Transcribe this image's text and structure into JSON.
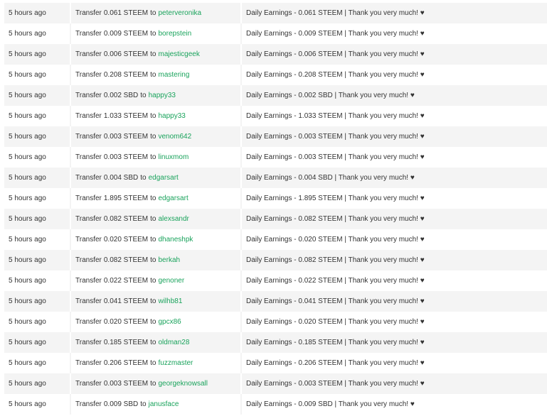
{
  "colors": {
    "link": "#1aa35c",
    "row_alt": "#f4f4f4",
    "text": "#333333"
  },
  "rows": [
    {
      "time": "5 hours ago",
      "verb": "Transfer",
      "amount": "0.061 STEEM",
      "conn": "to",
      "recipient": "peterveronika",
      "memo": "Daily Earnings - 0.061 STEEM | Thank you very much! ♥"
    },
    {
      "time": "5 hours ago",
      "verb": "Transfer",
      "amount": "0.009 STEEM",
      "conn": "to",
      "recipient": "borepstein",
      "memo": "Daily Earnings - 0.009 STEEM | Thank you very much! ♥"
    },
    {
      "time": "5 hours ago",
      "verb": "Transfer",
      "amount": "0.006 STEEM",
      "conn": "to",
      "recipient": "majesticgeek",
      "memo": "Daily Earnings - 0.006 STEEM | Thank you very much! ♥"
    },
    {
      "time": "5 hours ago",
      "verb": "Transfer",
      "amount": "0.208 STEEM",
      "conn": "to",
      "recipient": "mastering",
      "memo": "Daily Earnings - 0.208 STEEM | Thank you very much! ♥"
    },
    {
      "time": "5 hours ago",
      "verb": "Transfer",
      "amount": "0.002 SBD",
      "conn": "to",
      "recipient": "happy33",
      "memo": "Daily Earnings - 0.002 SBD | Thank you very much! ♥"
    },
    {
      "time": "5 hours ago",
      "verb": "Transfer",
      "amount": "1.033 STEEM",
      "conn": "to",
      "recipient": "happy33",
      "memo": "Daily Earnings - 1.033 STEEM | Thank you very much! ♥"
    },
    {
      "time": "5 hours ago",
      "verb": "Transfer",
      "amount": "0.003 STEEM",
      "conn": "to",
      "recipient": "venom642",
      "memo": "Daily Earnings - 0.003 STEEM | Thank you very much! ♥"
    },
    {
      "time": "5 hours ago",
      "verb": "Transfer",
      "amount": "0.003 STEEM",
      "conn": "to",
      "recipient": "linuxmom",
      "memo": "Daily Earnings - 0.003 STEEM | Thank you very much! ♥"
    },
    {
      "time": "5 hours ago",
      "verb": "Transfer",
      "amount": "0.004 SBD",
      "conn": "to",
      "recipient": "edgarsart",
      "memo": "Daily Earnings - 0.004 SBD | Thank you very much! ♥"
    },
    {
      "time": "5 hours ago",
      "verb": "Transfer",
      "amount": "1.895 STEEM",
      "conn": "to",
      "recipient": "edgarsart",
      "memo": "Daily Earnings - 1.895 STEEM | Thank you very much! ♥"
    },
    {
      "time": "5 hours ago",
      "verb": "Transfer",
      "amount": "0.082 STEEM",
      "conn": "to",
      "recipient": "alexsandr",
      "memo": "Daily Earnings - 0.082 STEEM | Thank you very much! ♥"
    },
    {
      "time": "5 hours ago",
      "verb": "Transfer",
      "amount": "0.020 STEEM",
      "conn": "to",
      "recipient": "dhaneshpk",
      "memo": "Daily Earnings - 0.020 STEEM | Thank you very much! ♥"
    },
    {
      "time": "5 hours ago",
      "verb": "Transfer",
      "amount": "0.082 STEEM",
      "conn": "to",
      "recipient": "berkah",
      "memo": "Daily Earnings - 0.082 STEEM | Thank you very much! ♥"
    },
    {
      "time": "5 hours ago",
      "verb": "Transfer",
      "amount": "0.022 STEEM",
      "conn": "to",
      "recipient": "genoner",
      "memo": "Daily Earnings - 0.022 STEEM | Thank you very much! ♥"
    },
    {
      "time": "5 hours ago",
      "verb": "Transfer",
      "amount": "0.041 STEEM",
      "conn": "to",
      "recipient": "wilhb81",
      "memo": "Daily Earnings - 0.041 STEEM | Thank you very much! ♥"
    },
    {
      "time": "5 hours ago",
      "verb": "Transfer",
      "amount": "0.020 STEEM",
      "conn": "to",
      "recipient": "gpcx86",
      "memo": "Daily Earnings - 0.020 STEEM | Thank you very much! ♥"
    },
    {
      "time": "5 hours ago",
      "verb": "Transfer",
      "amount": "0.185 STEEM",
      "conn": "to",
      "recipient": "oldman28",
      "memo": "Daily Earnings - 0.185 STEEM | Thank you very much! ♥"
    },
    {
      "time": "5 hours ago",
      "verb": "Transfer",
      "amount": "0.206 STEEM",
      "conn": "to",
      "recipient": "fuzzmaster",
      "memo": "Daily Earnings - 0.206 STEEM | Thank you very much! ♥"
    },
    {
      "time": "5 hours ago",
      "verb": "Transfer",
      "amount": "0.003 STEEM",
      "conn": "to",
      "recipient": "georgeknowsall",
      "memo": "Daily Earnings - 0.003 STEEM | Thank you very much! ♥"
    },
    {
      "time": "5 hours ago",
      "verb": "Transfer",
      "amount": "0.009 SBD",
      "conn": "to",
      "recipient": "janusface",
      "memo": "Daily Earnings - 0.009 SBD | Thank you very much! ♥"
    }
  ]
}
